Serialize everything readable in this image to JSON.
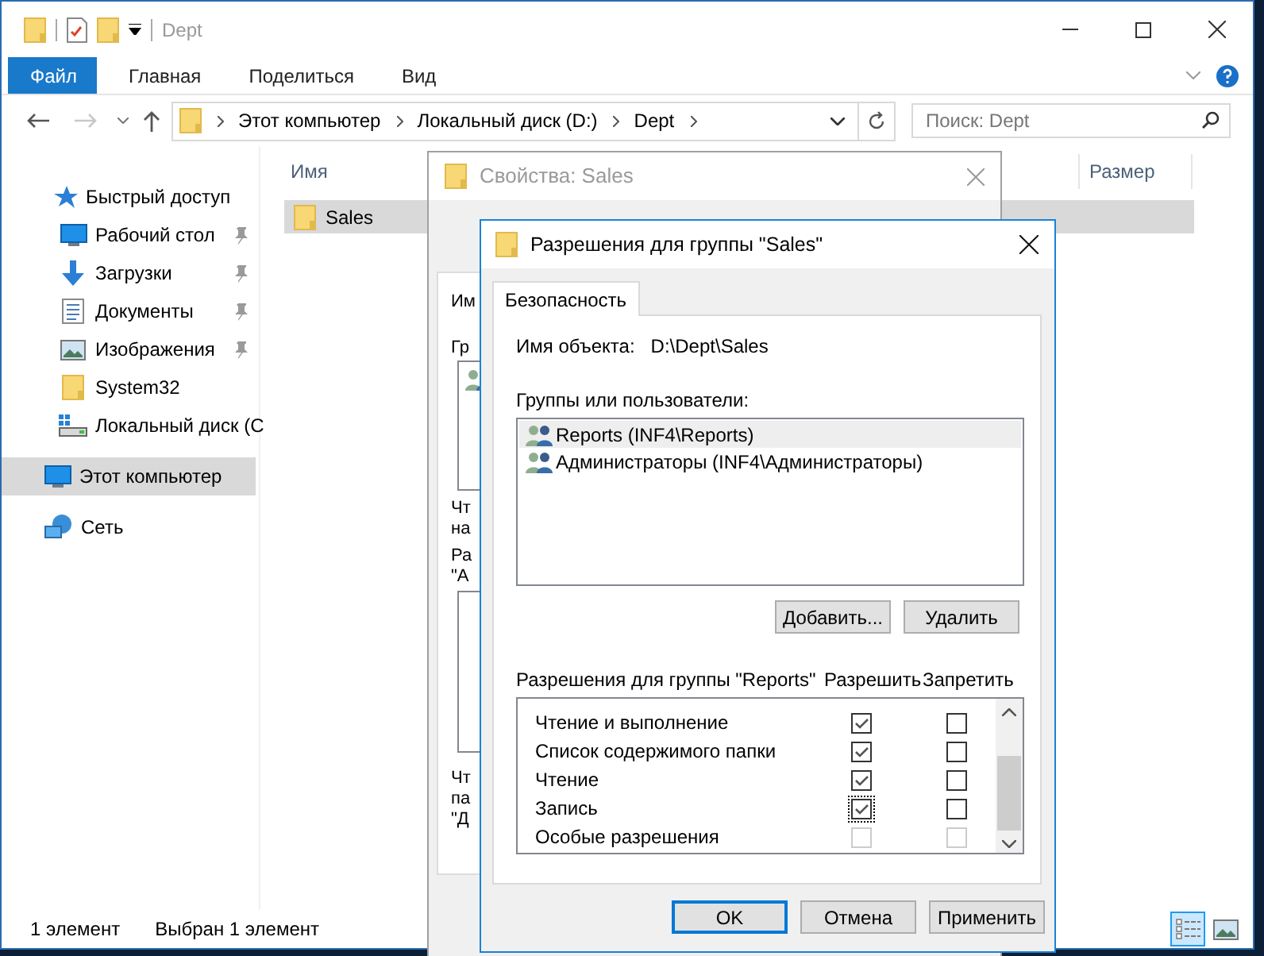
{
  "explorer": {
    "title": "Dept",
    "ribbon_tabs": [
      {
        "label": "Файл",
        "kind": "file"
      },
      {
        "label": "Главная",
        "kind": "tab"
      },
      {
        "label": "Поделиться",
        "kind": "tab"
      },
      {
        "label": "Вид",
        "kind": "tab"
      }
    ],
    "address": {
      "crumbs": [
        "Этот компьютер",
        "Локальный диск (D:)",
        "Dept"
      ]
    },
    "search": {
      "placeholder": "Поиск: Dept"
    },
    "sidebar": {
      "items": [
        {
          "label": "Быстрый доступ",
          "selected": false,
          "children": [
            {
              "label": "Рабочий стол",
              "pinned": true,
              "selected": false
            },
            {
              "label": "Загрузки",
              "pinned": true,
              "selected": false
            },
            {
              "label": "Документы",
              "pinned": true,
              "selected": false
            },
            {
              "label": "Изображения",
              "pinned": true,
              "selected": false
            },
            {
              "label": "System32",
              "pinned": false,
              "selected": false
            },
            {
              "label": "Локальный диск (C",
              "pinned": false,
              "selected": false
            }
          ]
        },
        {
          "label": "Этот компьютер",
          "selected": true
        },
        {
          "label": "Сеть",
          "selected": false
        }
      ]
    },
    "columns": [
      "Имя",
      "Размер"
    ],
    "files": [
      {
        "name": "Sales",
        "selected": true
      }
    ],
    "status_bar": {
      "count": "1 элемент",
      "selection": "Выбран 1 элемент",
      "views": [
        {
          "kind": "details",
          "selected": true
        },
        {
          "kind": "tiles",
          "selected": false
        }
      ]
    }
  },
  "properties_dialog": {
    "title": "Свойства: Sales",
    "fragments": [
      {
        "kind": "label",
        "lines": [
          "Им"
        ]
      },
      {
        "kind": "label",
        "lines": [
          "Гр"
        ]
      },
      {
        "kind": "list"
      },
      {
        "kind": "label",
        "lines": [
          "Чт",
          "на"
        ]
      },
      {
        "kind": "label",
        "lines": [
          "Ра",
          "\"А"
        ]
      },
      {
        "kind": "box"
      },
      {
        "kind": "label",
        "lines": [
          "Чт",
          "па",
          "\"Д"
        ]
      }
    ]
  },
  "permissions_dialog": {
    "title": "Разрешения для группы \"Sales\"",
    "tabs": [
      {
        "label": "Безопасность",
        "selected": true
      }
    ],
    "object_label": "Имя объекта:",
    "object_value": "D:\\Dept\\Sales",
    "groups_label": "Группы или пользователи:",
    "groups": [
      {
        "name": "Reports (INF4\\Reports)",
        "selected": true
      },
      {
        "name": "Администраторы (INF4\\Администраторы)",
        "selected": false
      }
    ],
    "group_buttons": [
      "Добавить...",
      "Удалить"
    ],
    "permissions_label": "Разрешения для группы \"Reports\"",
    "allow_header": "Разрешить",
    "deny_header": "Запретить",
    "permissions": [
      {
        "name": "Чтение и выполнение",
        "allow": true,
        "deny": false,
        "disabled": false,
        "focused": false
      },
      {
        "name": "Список содержимого папки",
        "allow": true,
        "deny": false,
        "disabled": false,
        "focused": false
      },
      {
        "name": "Чтение",
        "allow": true,
        "deny": false,
        "disabled": false,
        "focused": false
      },
      {
        "name": "Запись",
        "allow": true,
        "deny": false,
        "disabled": false,
        "focused": true
      },
      {
        "name": "Особые разрешения",
        "allow": false,
        "deny": false,
        "disabled": true,
        "focused": false
      }
    ],
    "buttons": [
      {
        "label": "OK",
        "default": true
      },
      {
        "label": "Отмена",
        "default": false
      },
      {
        "label": "Применить",
        "default": false
      }
    ]
  }
}
